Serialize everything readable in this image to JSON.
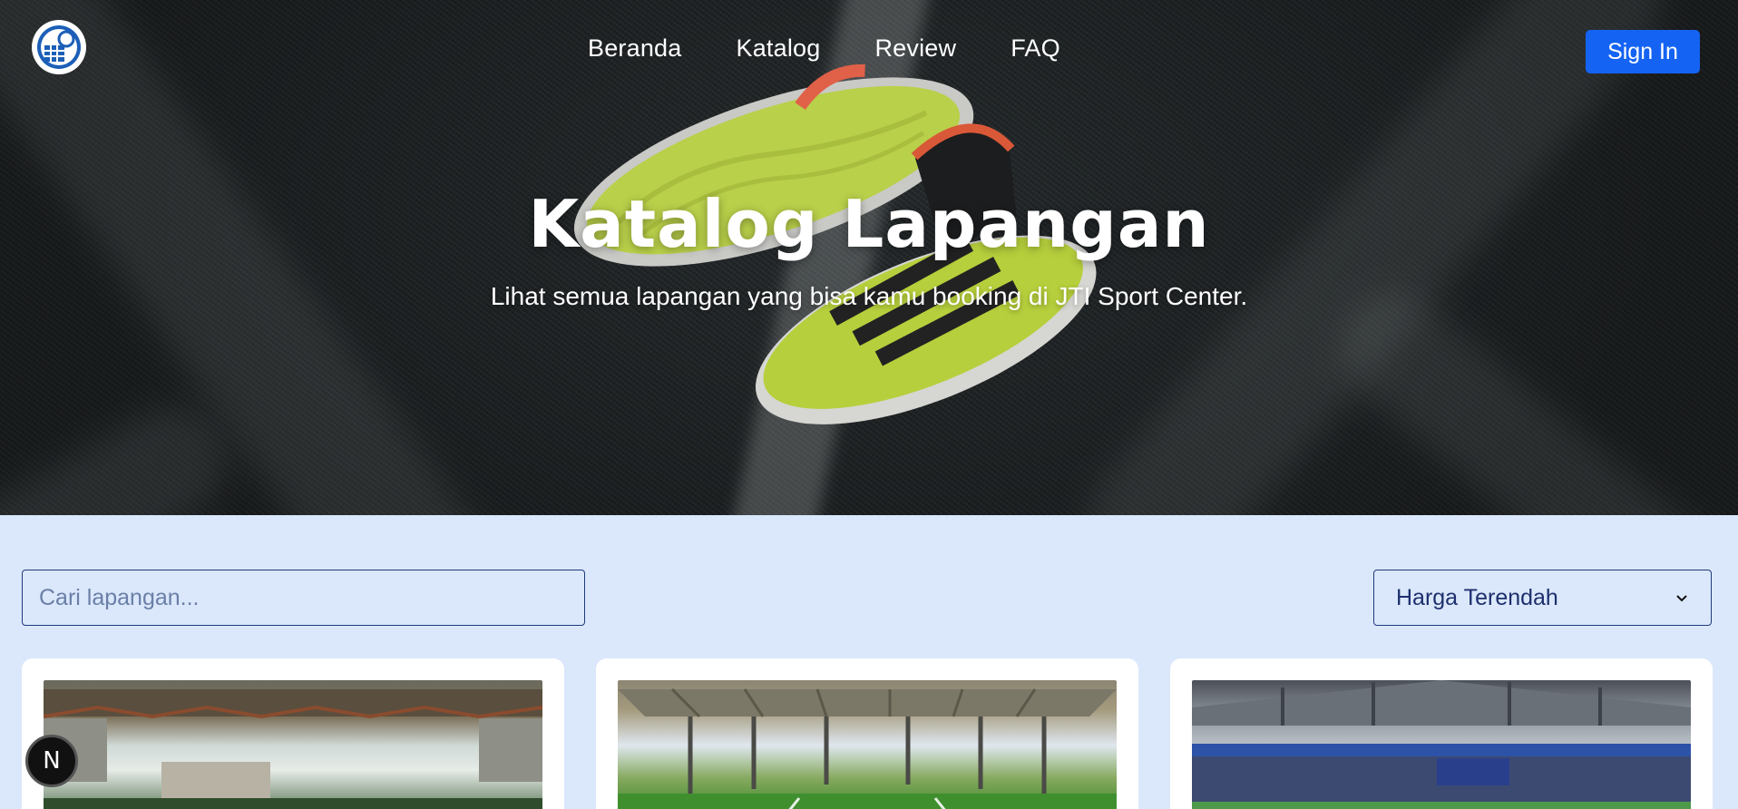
{
  "nav": {
    "logo_icon": "sport-center-globe-logo",
    "items": [
      {
        "label": "Beranda"
      },
      {
        "label": "Katalog"
      },
      {
        "label": "Review"
      },
      {
        "label": "FAQ"
      }
    ],
    "signin_label": "Sign In"
  },
  "hero": {
    "title": "Katalog Lapangan",
    "subtitle": "Lihat semua lapangan yang bisa kamu booking di JTI Sport Center."
  },
  "filters": {
    "search_placeholder": "Cari lapangan...",
    "sort_selected": "Harga Terendah"
  },
  "dev_badge": {
    "label": "N"
  },
  "colors": {
    "accent": "#1463f3",
    "page_bg": "#dbe8fb",
    "input_border": "#1e3a7a"
  }
}
